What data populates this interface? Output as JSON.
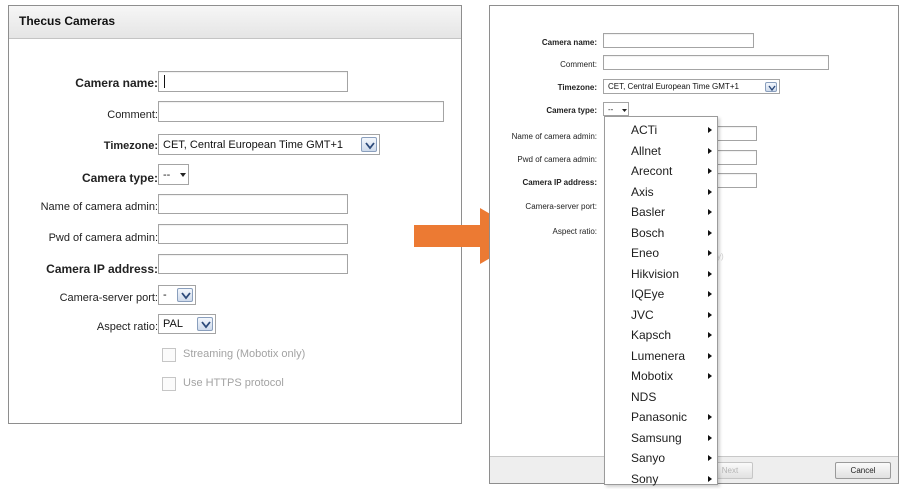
{
  "left": {
    "title": "Thecus Cameras",
    "fields": {
      "camera_name_label": "Camera name:",
      "comment_label": "Comment:",
      "timezone_label": "Timezone:",
      "timezone_value": "CET, Central European Time GMT+1",
      "camera_type_label": "Camera type:",
      "camera_type_value": "--",
      "admin_name_label": "Name of camera admin:",
      "admin_pwd_label": "Pwd of camera admin:",
      "ip_label": "Camera IP address:",
      "port_label": "Camera-server port:",
      "port_value": "-",
      "aspect_label": "Aspect ratio:",
      "aspect_value": "PAL",
      "streaming_label": "Streaming (Mobotix only)",
      "https_label": "Use HTTPS protocol"
    }
  },
  "right": {
    "fields": {
      "camera_name_label": "Camera name:",
      "comment_label": "Comment:",
      "timezone_label": "Timezone:",
      "timezone_value": "CET, Central European Time GMT+1",
      "camera_type_label": "Camera type:",
      "camera_type_value": "--",
      "admin_name_label": "Name of camera admin:",
      "admin_pwd_label": "Pwd of camera admin:",
      "ip_label": "Camera IP address:",
      "port_label": "Camera-server port:",
      "aspect_label": "Aspect ratio:",
      "partial_text": "y)"
    },
    "buttons": {
      "next": "Next",
      "cancel": "Cancel"
    },
    "camera_types": [
      {
        "label": "ACTi",
        "submenu": true
      },
      {
        "label": "Allnet",
        "submenu": true
      },
      {
        "label": "Arecont",
        "submenu": true
      },
      {
        "label": "Axis",
        "submenu": true
      },
      {
        "label": "Basler",
        "submenu": true
      },
      {
        "label": "Bosch",
        "submenu": true
      },
      {
        "label": "Eneo",
        "submenu": true
      },
      {
        "label": "Hikvision",
        "submenu": true
      },
      {
        "label": "IQEye",
        "submenu": true
      },
      {
        "label": "JVC",
        "submenu": true
      },
      {
        "label": "Kapsch",
        "submenu": true
      },
      {
        "label": "Lumenera",
        "submenu": true
      },
      {
        "label": "Mobotix",
        "submenu": true
      },
      {
        "label": "NDS",
        "submenu": false
      },
      {
        "label": "Panasonic",
        "submenu": true
      },
      {
        "label": "Samsung",
        "submenu": true
      },
      {
        "label": "Sanyo",
        "submenu": true
      },
      {
        "label": "Sony",
        "submenu": true
      }
    ]
  },
  "colors": {
    "arrow": "#ec7a33",
    "border": "#8e8e8e",
    "dropdown_button": "#cfdbec"
  },
  "icons": {
    "dropdown": "chevron-down-icon",
    "mini_caret": "caret-down-icon",
    "submenu": "caret-right-icon",
    "arrow": "arrow-right-icon"
  }
}
